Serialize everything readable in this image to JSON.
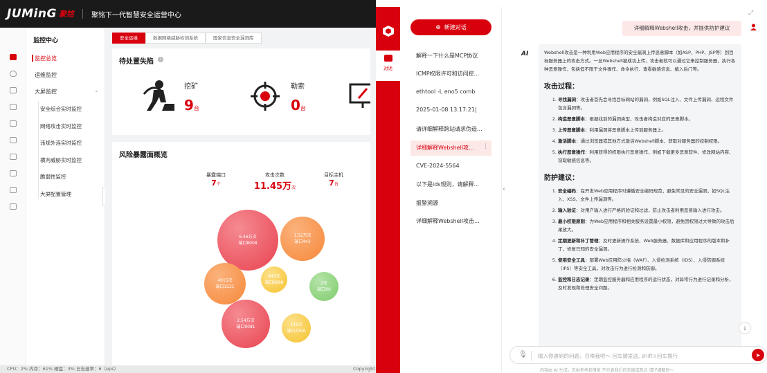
{
  "topbar": {
    "logo": "JUMinG",
    "logo_cn": "聚铭",
    "title": "聚铭下一代智慧安全运营中心"
  },
  "nav": {
    "header": "监控中心",
    "items": [
      {
        "label": "监控总览",
        "active": true
      },
      {
        "label": "运维监控",
        "active": false
      },
      {
        "label": "大屏监控",
        "active": false
      }
    ],
    "sub_items": [
      "安全综合实时监控",
      "网络攻击实时监控",
      "违规外连实时监控",
      "横向威胁实时监控",
      "脆弱性监控",
      "大屏配置管理"
    ]
  },
  "main": {
    "tabs": [
      "安全运维",
      "数据网络威胁检测系统",
      "国家信息安全漏洞库"
    ],
    "pending": {
      "title": "待处置失陷",
      "items": [
        {
          "label": "挖矿",
          "value": "9",
          "unit": "台"
        },
        {
          "label": "勒索",
          "value": "0",
          "unit": "台"
        }
      ]
    },
    "risk": {
      "title": "风险暴露面概览",
      "stats": [
        {
          "label": "暴露端口",
          "value": "7",
          "unit": "个"
        },
        {
          "label": "攻击次数",
          "value": "11.45万",
          "unit": "次"
        },
        {
          "label": "目标主机",
          "value": "7",
          "unit": "台"
        }
      ],
      "bubbles": [
        {
          "count": "6.46万次",
          "port": "端口8008",
          "color": "#e8434f"
        },
        {
          "count": "1.52万次",
          "port": "端口443",
          "color": "#f6883a"
        },
        {
          "count": "4015次",
          "port": "端口1521",
          "color": "#f6883a"
        },
        {
          "count": "449次",
          "port": "端口8888",
          "color": "#f5c330"
        },
        {
          "count": "2次",
          "port": "端口80",
          "color": "#7fcc6c"
        },
        {
          "count": "2.54万次",
          "port": "端口9081",
          "color": "#e8434f"
        },
        {
          "count": "143次",
          "port": "端口3306",
          "color": "#f5c330"
        }
      ]
    }
  },
  "statusbar": "CPU：2%  内存：61%  硬盘：3%  日志速率：6（eps）",
  "statusbar_right": "Copyright",
  "redstrip": {
    "chat_tab": "对话"
  },
  "chatlist": {
    "new_chat": "新建对话",
    "items": [
      "解释一下什么是MCP协议",
      "ICMP权限许可和访问控...",
      "ethtool -L eno5 comb",
      "2025-01-08 13:17:21|",
      "请详细解释跨站请求伪造...",
      "详细解释Webshell攻...",
      "CVE-2024-5564",
      "以下是ids规则，请解释...",
      "报警溯源",
      "详细解释Webshell攻击..."
    ],
    "active_index": 5
  },
  "chat": {
    "user_message": "详细解释Webshell攻击，并提供防护建议",
    "ai_label": "AI",
    "intro": "Webshell攻击是一种利用Web应用程序的安全漏洞上传恶意脚本（如ASP、PHP、JSP等）到目标服务器上的攻击方式。一旦Webshell被成功上传，攻击者就可以通过它来控制服务器，执行各种恶意操作，包括但不限于文件操作、命令执行、查看敏感信息、植入后门等。",
    "section1_title": "攻击过程：",
    "section1": [
      {
        "k": "寻找漏洞",
        "v": "：攻击者首先会寻找目标网站的漏洞，例如SQL注入、文件上传漏洞、远程文件包含漏洞等。"
      },
      {
        "k": "构造恶意脚本",
        "v": "：根据找到的漏洞类型，攻击者构造对应的恶意脚本。"
      },
      {
        "k": "上传恶意脚本",
        "v": "：利用漏洞将恶意脚本上传到服务器上。"
      },
      {
        "k": "激活脚本",
        "v": "：通过浏览器或其他方式激活Webshell脚本，获取对服务器的控制权限。"
      },
      {
        "k": "执行恶意操作",
        "v": "：利用获得的权限执行恶意操作，例如下载更多恶意软件、修改网站内容、窃取敏感信息等。"
      }
    ],
    "section2_title": "防护建议：",
    "section2": [
      {
        "k": "安全编码",
        "v": "：在开发Web应用程序时遵循安全编码规范，避免常见的安全漏洞，如SQL注入、XSS、文件上传漏洞等。"
      },
      {
        "k": "输入验证",
        "v": "：对用户输入进行严格的验证和过滤，防止攻击者利用恶意输入进行攻击。"
      },
      {
        "k": "最小权限原则",
        "v": "：为Web应用程序和相关服务设置最小权限，避免因权限过大导致的攻击后果放大。"
      },
      {
        "k": "定期更新和补丁管理",
        "v": "：及时更新操作系统、Web服务器、数据库和应用程序的版本和补丁，修复已知的安全漏洞。"
      },
      {
        "k": "使用安全工具",
        "v": "：部署Web应用防火墙（WAF）、入侵检测系统（IDS）、入侵防御系统（IPS）等安全工具，对攻击行为进行检测和防御。"
      },
      {
        "k": "监控和日志记录",
        "v": "：定期监控服务器和应用程序的运行状态，对异常行为进行记录和分析，及时发现和处理安全问题。"
      }
    ],
    "input_placeholder": "输入你遇到的问题，召唤我吧～ 回车键发送, shift+回车换行",
    "footnote": "内容由 AI 生成，仅供参考和借鉴 不代表我们的态度或观点 请仔细甄别～"
  }
}
